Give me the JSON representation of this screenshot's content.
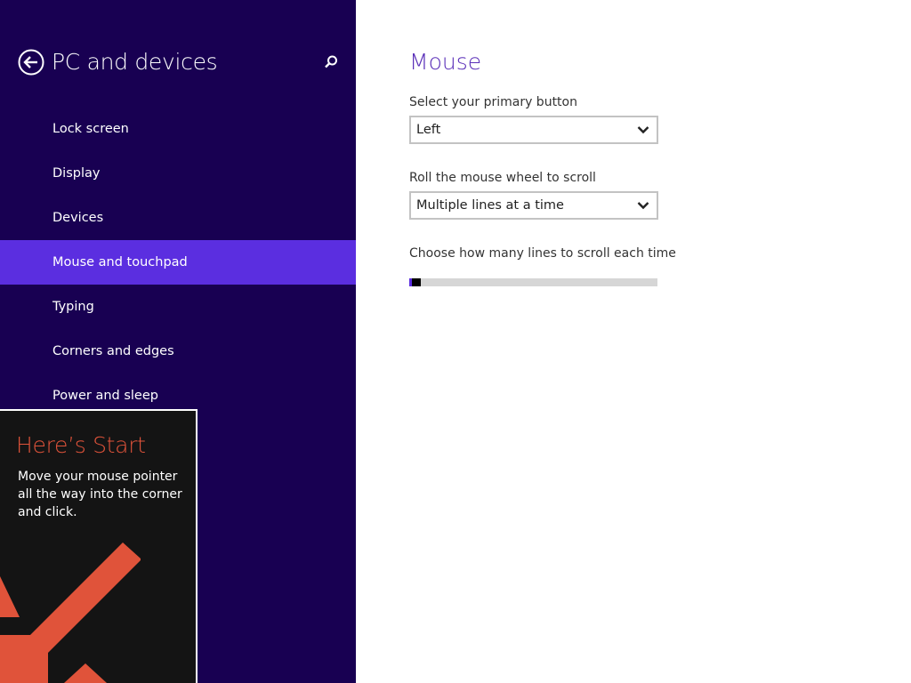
{
  "nav": {
    "title": "PC and devices",
    "back_icon": "back-arrow-icon",
    "search_icon": "search-icon",
    "items": [
      {
        "label": "Lock screen",
        "selected": false
      },
      {
        "label": "Display",
        "selected": false
      },
      {
        "label": "Devices",
        "selected": false
      },
      {
        "label": "Mouse and touchpad",
        "selected": true
      },
      {
        "label": "Typing",
        "selected": false
      },
      {
        "label": "Corners and edges",
        "selected": false
      },
      {
        "label": "Power and sleep",
        "selected": false
      }
    ]
  },
  "start_tip": {
    "title": "Here’s Start",
    "body": "Move your mouse pointer all the way into the corner and click.",
    "arrow_icon": "arrow-down-left-icon"
  },
  "main": {
    "title": "Mouse",
    "primary_button": {
      "label": "Select your primary button",
      "value": "Left"
    },
    "wheel_scroll": {
      "label": "Roll the mouse wheel to scroll",
      "value": "Multiple lines at a time"
    },
    "lines_to_scroll": {
      "label": "Choose how many lines to scroll each time",
      "level_fraction": 0.0
    }
  },
  "colors": {
    "nav_background": "#180052",
    "nav_selected": "#5b2ee0",
    "accent_title": "#5a2fb8",
    "tip_title": "#e0533a",
    "tip_arrow": "#e0533a",
    "tip_background": "#141414"
  }
}
